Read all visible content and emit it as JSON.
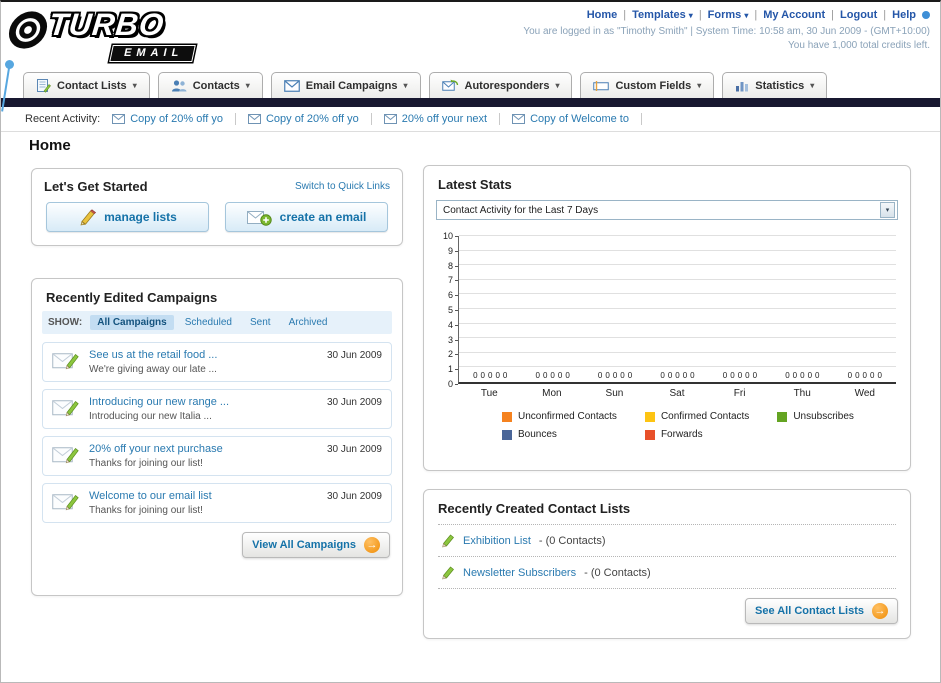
{
  "header": {
    "logo_line1": "TURBO",
    "logo_line2": "EMAIL",
    "links": [
      "Home",
      "Templates",
      "Forms",
      "My Account",
      "Logout",
      "Help"
    ],
    "logged_in_text": "You are logged in as \"Timothy Smith\" | System Time: 10:58 am, 30 Jun 2009 - (GMT+10:00)",
    "credits_text": "You have 1,000 total credits left."
  },
  "nav_tabs": [
    {
      "label": "Contact Lists"
    },
    {
      "label": "Contacts"
    },
    {
      "label": "Email Campaigns"
    },
    {
      "label": "Autoresponders"
    },
    {
      "label": "Custom Fields"
    },
    {
      "label": "Statistics"
    }
  ],
  "recent_activity": {
    "label": "Recent Activity:",
    "items": [
      "Copy of 20% off yo",
      "Copy of 20% off yo",
      "20% off your next",
      "Copy of Welcome to"
    ]
  },
  "page": {
    "title": "Home"
  },
  "get_started": {
    "title": "Let's Get Started",
    "switch_link": "Switch to Quick Links",
    "manage_lists_label": "manage lists",
    "create_email_label": "create an email"
  },
  "campaigns": {
    "title": "Recently Edited Campaigns",
    "show_label": "SHOW:",
    "filters": [
      "All Campaigns",
      "Scheduled",
      "Sent",
      "Archived"
    ],
    "active_filter": "All Campaigns",
    "items": [
      {
        "title": "See us at the retail food ...",
        "subtitle": "We're giving away our late ...",
        "date": "30 Jun 2009"
      },
      {
        "title": "Introducing our new range ...",
        "subtitle": "Introducing our new Italia ...",
        "date": "30 Jun 2009"
      },
      {
        "title": "20% off your next purchase",
        "subtitle": "Thanks for joining our list!",
        "date": "30 Jun 2009"
      },
      {
        "title": "Welcome to our email list",
        "subtitle": "Thanks for joining our list!",
        "date": "30 Jun 2009"
      }
    ],
    "view_all_label": "View All Campaigns"
  },
  "latest_stats": {
    "title": "Latest Stats",
    "dropdown_value": "Contact Activity for the Last 7 Days",
    "chart_data": {
      "type": "bar",
      "title": "Contact Activity for the Last 7 Days",
      "categories": [
        "Tue",
        "Mon",
        "Sun",
        "Sat",
        "Fri",
        "Thu",
        "Wed"
      ],
      "series": [
        {
          "name": "Unconfirmed Contacts",
          "color": "#f5821f",
          "values": [
            0,
            0,
            0,
            0,
            0,
            0,
            0
          ]
        },
        {
          "name": "Confirmed Contacts",
          "color": "#fdc413",
          "values": [
            0,
            0,
            0,
            0,
            0,
            0,
            0
          ]
        },
        {
          "name": "Unsubscribes",
          "color": "#64a422",
          "values": [
            0,
            0,
            0,
            0,
            0,
            0,
            0
          ]
        },
        {
          "name": "Bounces",
          "color": "#4a6699",
          "values": [
            0,
            0,
            0,
            0,
            0,
            0,
            0
          ]
        },
        {
          "name": "Forwards",
          "color": "#e8502a",
          "values": [
            0,
            0,
            0,
            0,
            0,
            0,
            0
          ]
        }
      ],
      "ylim": [
        0,
        10
      ],
      "grid": true,
      "legend_position": "bottom"
    }
  },
  "contact_lists": {
    "title": "Recently Created Contact Lists",
    "items": [
      {
        "name": "Exhibition List",
        "detail": " - (0 Contacts)"
      },
      {
        "name": "Newsletter Subscribers",
        "detail": " - (0 Contacts)"
      }
    ],
    "see_all_label": "See All Contact Lists"
  }
}
